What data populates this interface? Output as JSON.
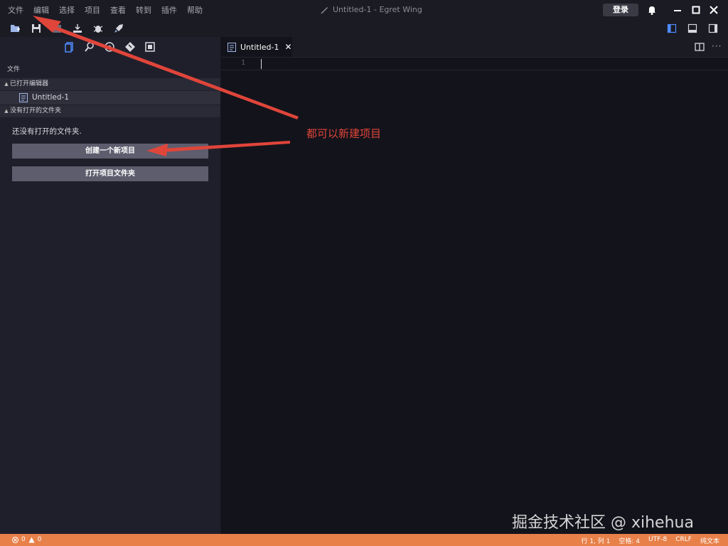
{
  "window": {
    "title": "Untitled-1 - Egret Wing"
  },
  "menu": [
    "文件",
    "编辑",
    "选择",
    "项目",
    "查看",
    "转到",
    "插件",
    "帮助"
  ],
  "header": {
    "login_label": "登录"
  },
  "sidebar": {
    "title": "文件",
    "open_editors_label": "已打开编辑器",
    "open_file": "Untitled-1",
    "no_folder_section": "没有打开的文件夹",
    "no_folder_text": "还没有打开的文件夹.",
    "create_button": "创建一个新项目",
    "open_button": "打开项目文件夹"
  },
  "editor": {
    "tab_label": "Untitled-1",
    "close_glyph": "✕",
    "more_glyph": "···",
    "line_number": "1"
  },
  "annotation": {
    "text": "都可以新建项目"
  },
  "watermark": "掘金技术社区 @ xihehua",
  "statusbar": {
    "errors": "0",
    "warnings": "0",
    "position": "行 1, 列 1",
    "spaces": "空格: 4",
    "encoding": "UTF-8",
    "eol": "CRLF",
    "language": "纯文本"
  },
  "colors": {
    "accent": "#e8804a",
    "annotation": "#e0453a",
    "active_icon": "#4f8cff"
  }
}
